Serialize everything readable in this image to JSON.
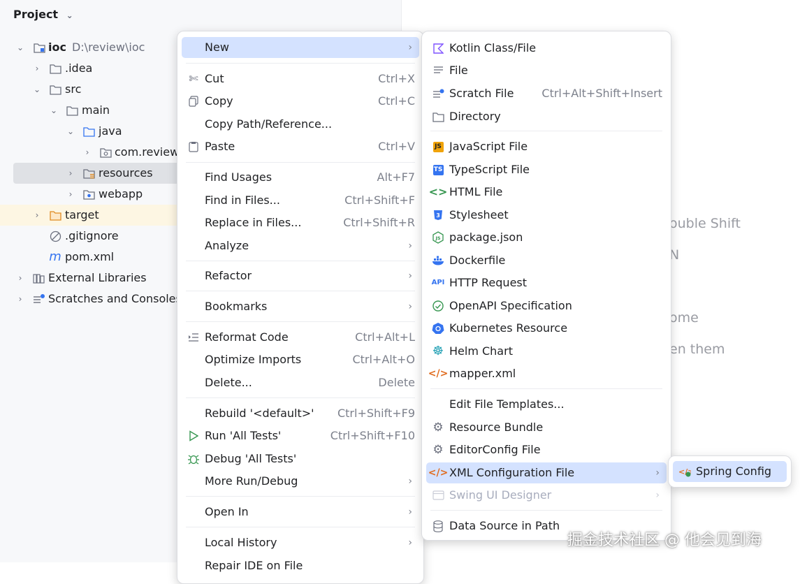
{
  "panel": {
    "title": "Project"
  },
  "tree": [
    {
      "label": "ioc",
      "detail": "D:\\review\\ioc",
      "icon": "module-folder-icon"
    },
    {
      "label": ".idea",
      "icon": "folder-icon"
    },
    {
      "label": "src",
      "icon": "folder-icon"
    },
    {
      "label": "main",
      "icon": "folder-icon"
    },
    {
      "label": "java",
      "icon": "source-folder-icon"
    },
    {
      "label": "com.review",
      "icon": "package-icon"
    },
    {
      "label": "resources",
      "icon": "resources-folder-icon"
    },
    {
      "label": "webapp",
      "icon": "web-folder-icon"
    },
    {
      "label": "target",
      "icon": "excluded-folder-icon"
    },
    {
      "label": ".gitignore",
      "icon": "ignore-file-icon"
    },
    {
      "label": "pom.xml",
      "icon": "maven-icon"
    },
    {
      "label": "External Libraries",
      "icon": "library-icon"
    },
    {
      "label": "Scratches and Consoles",
      "icon": "scratches-icon"
    }
  ],
  "editor_hints": [
    "ouble Shift",
    "N",
    "ome",
    "en them"
  ],
  "context_menu": [
    {
      "label": "New",
      "arrow": true
    },
    {
      "label": "Cut",
      "shortcut": "Ctrl+X",
      "icon": "scissors-icon"
    },
    {
      "label": "Copy",
      "shortcut": "Ctrl+C",
      "icon": "copy-icon"
    },
    {
      "label": "Copy Path/Reference..."
    },
    {
      "label": "Paste",
      "shortcut": "Ctrl+V",
      "icon": "paste-icon"
    },
    {
      "label": "Find Usages",
      "shortcut": "Alt+F7"
    },
    {
      "label": "Find in Files...",
      "shortcut": "Ctrl+Shift+F"
    },
    {
      "label": "Replace in Files...",
      "shortcut": "Ctrl+Shift+R"
    },
    {
      "label": "Analyze",
      "arrow": true
    },
    {
      "label": "Refactor",
      "arrow": true
    },
    {
      "label": "Bookmarks",
      "arrow": true
    },
    {
      "label": "Reformat Code",
      "shortcut": "Ctrl+Alt+L",
      "icon": "reformat-icon"
    },
    {
      "label": "Optimize Imports",
      "shortcut": "Ctrl+Alt+O"
    },
    {
      "label": "Delete...",
      "shortcut": "Delete"
    },
    {
      "label": "Rebuild '<default>'",
      "shortcut": "Ctrl+Shift+F9"
    },
    {
      "label": "Run 'All Tests'",
      "shortcut": "Ctrl+Shift+F10",
      "icon": "run-icon"
    },
    {
      "label": "Debug 'All Tests'",
      "icon": "debug-icon"
    },
    {
      "label": "More Run/Debug",
      "arrow": true
    },
    {
      "label": "Open In",
      "arrow": true
    },
    {
      "label": "Local History",
      "arrow": true
    },
    {
      "label": "Repair IDE on File"
    }
  ],
  "new_submenu": [
    {
      "label": "Kotlin Class/File",
      "icon": "kotlin-icon"
    },
    {
      "label": "File",
      "icon": "file-icon"
    },
    {
      "label": "Scratch File",
      "shortcut": "Ctrl+Alt+Shift+Insert",
      "icon": "scratch-file-icon"
    },
    {
      "label": "Directory",
      "icon": "folder-icon"
    },
    {
      "label": "JavaScript File",
      "icon": "javascript-icon"
    },
    {
      "label": "TypeScript File",
      "icon": "typescript-icon"
    },
    {
      "label": "HTML File",
      "icon": "html-icon"
    },
    {
      "label": "Stylesheet",
      "icon": "css-icon"
    },
    {
      "label": "package.json",
      "icon": "nodejs-icon"
    },
    {
      "label": "Dockerfile",
      "icon": "docker-icon"
    },
    {
      "label": "HTTP Request",
      "icon": "api-icon"
    },
    {
      "label": "OpenAPI Specification",
      "icon": "openapi-icon"
    },
    {
      "label": "Kubernetes Resource",
      "icon": "kubernetes-icon"
    },
    {
      "label": "Helm Chart",
      "icon": "helm-icon"
    },
    {
      "label": "mapper.xml",
      "icon": "xml-icon"
    },
    {
      "label": "Edit File Templates..."
    },
    {
      "label": "Resource Bundle",
      "icon": "gear-icon"
    },
    {
      "label": "EditorConfig File",
      "icon": "gear-icon"
    },
    {
      "label": "XML Configuration File",
      "arrow": true,
      "icon": "xml-icon"
    },
    {
      "label": "Swing UI Designer",
      "arrow": true,
      "icon": "window-icon"
    },
    {
      "label": "Data Source in Path",
      "icon": "database-icon"
    }
  ],
  "xml_submenu": [
    {
      "label": "Spring Config",
      "icon": "spring-xml-icon"
    }
  ],
  "watermark": "掘金技术社区 @ 他会见到海",
  "colors": {
    "accent": "#3574f0",
    "selection": "#d4e2ff",
    "tree_selection": "#dfe1e5",
    "excluded": "#fdf6e3"
  }
}
